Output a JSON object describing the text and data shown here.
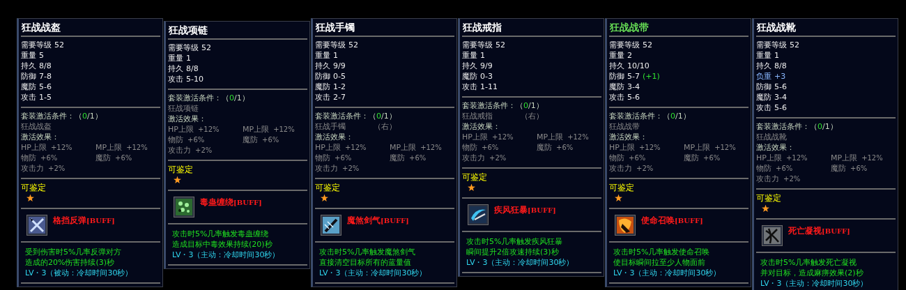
{
  "items": [
    {
      "title": "狂战战盔",
      "color": "#ffffff",
      "stats": [
        {
          "label": "需要等级",
          "value": "52",
          "kind": "base"
        },
        {
          "label": "重量",
          "value": "5",
          "kind": "base"
        },
        {
          "label": "持久",
          "value": "8/8",
          "kind": "base"
        },
        {
          "label": "防御",
          "value": "7-8",
          "kind": "base"
        },
        {
          "label": "魔防",
          "value": "5-6",
          "kind": "base"
        },
        {
          "label": "攻击",
          "value": "1-5",
          "kind": "base"
        }
      ],
      "set": {
        "active": false,
        "label": "套装激活条件：",
        "progress": {
          "before": "（",
          "count": "0",
          "after": "/1）"
        },
        "pieces": [
          {
            "name": "狂战战盔"
          }
        ],
        "effects_label": "激活效果：",
        "effects": [
          {
            "label": "HP上限",
            "value": "+12%"
          },
          {
            "label": "MP上限",
            "value": "+12%"
          },
          {
            "label": "物防",
            "value": "+6%"
          },
          {
            "label": "魔防",
            "value": "+6%"
          },
          {
            "label": "攻击力",
            "value": "+2%"
          }
        ]
      },
      "identify": "可鉴定",
      "skill": {
        "name": "格挡反弹",
        "tag": "[BUFF]",
        "lines": [
          "受到伤害时5%几率反弹对方",
          "造成的20%伤害持续(3)秒"
        ],
        "level_line": "LV・3（被动：冷却时间30秒）"
      }
    },
    {
      "title": "狂战项链",
      "color": "#ffffff",
      "stats": [
        {
          "label": "需要等级",
          "value": "52",
          "kind": "base"
        },
        {
          "label": "重量",
          "value": "1",
          "kind": "base"
        },
        {
          "label": "持久",
          "value": "8/8",
          "kind": "base"
        },
        {
          "label": "攻击",
          "value": "5-10",
          "kind": "base"
        }
      ],
      "set": {
        "active": false,
        "label": "套装激活条件：",
        "progress": {
          "before": "（",
          "count": "0",
          "after": "/1）"
        },
        "pieces": [
          {
            "name": "狂战项链"
          }
        ],
        "effects_label": "激活效果：",
        "effects": [
          {
            "label": "HP上限",
            "value": "+12%"
          },
          {
            "label": "MP上限",
            "value": "+12%"
          },
          {
            "label": "物防",
            "value": "+6%"
          },
          {
            "label": "魔防",
            "value": "+6%"
          },
          {
            "label": "攻击力",
            "value": "+2%"
          }
        ]
      },
      "identify": "可鉴定",
      "skill": {
        "name": "毒蛊缠绕",
        "tag": "[BUFF]",
        "lines": [
          "攻击时5%几率触发毒蛊缠绕",
          "造成目标中毒效果持续(20)秒"
        ],
        "level_line": "LV・3（主动：冷却时间30秒）"
      }
    },
    {
      "title": "狂战手镯",
      "color": "#ffffff",
      "stats": [
        {
          "label": "需要等级",
          "value": "52",
          "kind": "base"
        },
        {
          "label": "重量",
          "value": "1",
          "kind": "base"
        },
        {
          "label": "持久",
          "value": "9/9",
          "kind": "base"
        },
        {
          "label": "防御",
          "value": "0-5",
          "kind": "base"
        },
        {
          "label": "魔防",
          "value": "1-2",
          "kind": "base"
        },
        {
          "label": "攻击",
          "value": "2-7",
          "kind": "base"
        }
      ],
      "set": {
        "active": false,
        "label": "套装激活条件：",
        "progress": {
          "before": "（",
          "count": "0",
          "after": "/1）"
        },
        "pieces": [
          {
            "name": "狂战手镯",
            "slot": "（右）"
          }
        ],
        "effects_label": "激活效果：",
        "effects": [
          {
            "label": "HP上限",
            "value": "+12%"
          },
          {
            "label": "MP上限",
            "value": "+12%"
          },
          {
            "label": "物防",
            "value": "+6%"
          },
          {
            "label": "魔防",
            "value": "+6%"
          },
          {
            "label": "攻击力",
            "value": "+2%"
          }
        ]
      },
      "identify": "可鉴定",
      "skill": {
        "name": "魔煞剑气",
        "tag": "[BUFF]",
        "lines": [
          "攻击时5%几率触发魔煞剑气",
          "直接清空目标所有的蓝量值"
        ],
        "level_line": "LV・3（主动：冷却时间30秒）"
      }
    },
    {
      "title": "狂战戒指",
      "color": "#ffffff",
      "stats": [
        {
          "label": "需要等级",
          "value": "52",
          "kind": "base"
        },
        {
          "label": "重量",
          "value": "1",
          "kind": "base"
        },
        {
          "label": "持久",
          "value": "9/9",
          "kind": "base"
        },
        {
          "label": "魔防",
          "value": "0-3",
          "kind": "base"
        },
        {
          "label": "攻击",
          "value": "1-11",
          "kind": "base"
        }
      ],
      "set": {
        "active": false,
        "label": "套装激活条件：",
        "progress": {
          "before": "（",
          "count": "0",
          "after": "/1）"
        },
        "pieces": [
          {
            "name": "狂战戒指",
            "slot": "（右）"
          }
        ],
        "effects_label": "激活效果：",
        "effects": [
          {
            "label": "HP上限",
            "value": "+12%"
          },
          {
            "label": "MP上限",
            "value": "+12%"
          },
          {
            "label": "物防",
            "value": "+6%"
          },
          {
            "label": "魔防",
            "value": "+6%"
          },
          {
            "label": "攻击力",
            "value": "+2%"
          }
        ]
      },
      "identify": "可鉴定",
      "skill": {
        "name": "疾风狂暴",
        "tag": "[BUFF]",
        "lines": [
          "攻击时5%几率触发疾风狂暴",
          "瞬间提升2倍攻速持续(3)秒"
        ],
        "level_line": "LV・3（主动：冷却时间30秒）"
      }
    },
    {
      "title": "狂战战带",
      "color": "#66dd55",
      "stats": [
        {
          "label": "需要等级",
          "value": "52",
          "kind": "base"
        },
        {
          "label": "重量",
          "value": "2",
          "kind": "base"
        },
        {
          "label": "持久",
          "value": "10/10",
          "kind": "base"
        },
        {
          "label": "防御",
          "value": "5-7",
          "bonus": "(+1)",
          "kind": "base"
        },
        {
          "label": "魔防",
          "value": "3-4",
          "kind": "base"
        },
        {
          "label": "攻击",
          "value": "5-6",
          "kind": "base"
        }
      ],
      "set": {
        "active": false,
        "label": "套装激活条件：",
        "progress": {
          "before": "（",
          "count": "0",
          "after": "/1）"
        },
        "pieces": [
          {
            "name": "狂战战带"
          }
        ],
        "effects_label": "激活效果：",
        "effects": [
          {
            "label": "HP上限",
            "value": "+12%"
          },
          {
            "label": "MP上限",
            "value": "+12%"
          },
          {
            "label": "物防",
            "value": "+6%"
          },
          {
            "label": "魔防",
            "value": "+6%"
          },
          {
            "label": "攻击力",
            "value": "+2%"
          }
        ]
      },
      "identify": "可鉴定",
      "skill": {
        "name": "使命召唤",
        "tag": "[BUFF]",
        "lines": [
          "攻击时5%几率触发使命召唤",
          "使目标瞬间拉至少人物面前"
        ],
        "level_line": "LV・3（主动：冷却时间30秒）"
      }
    },
    {
      "title": "狂战战靴",
      "color": "#ffffff",
      "stats": [
        {
          "label": "需要等级",
          "value": "52",
          "kind": "base"
        },
        {
          "label": "重量",
          "value": "1",
          "kind": "base"
        },
        {
          "label": "持久",
          "value": "8/8",
          "kind": "base"
        },
        {
          "label": "负重",
          "value": "+3",
          "kind": "extra"
        },
        {
          "label": "防御",
          "value": "5-6",
          "kind": "base"
        },
        {
          "label": "魔防",
          "value": "3-4",
          "kind": "base"
        },
        {
          "label": "攻击",
          "value": "5-6",
          "kind": "base"
        }
      ],
      "set": {
        "active": false,
        "label": "套装激活条件：",
        "progress": {
          "before": "（",
          "count": "0",
          "after": "/1）"
        },
        "pieces": [
          {
            "name": "狂战战靴"
          }
        ],
        "effects_label": "激活效果：",
        "effects": [
          {
            "label": "HP上限",
            "value": "+12%"
          },
          {
            "label": "MP上限",
            "value": "+12%"
          },
          {
            "label": "物防",
            "value": "+6%"
          },
          {
            "label": "魔防",
            "value": "+6%"
          },
          {
            "label": "攻击力",
            "value": "+2%"
          }
        ]
      },
      "identify": "可鉴定",
      "skill": {
        "name": "死亡凝视",
        "tag": "[BUFF]",
        "lines": [
          "攻击时5%几率触发死亡凝视",
          "并对目标，造成麻痹效果(2)秒"
        ],
        "level_line": "LV・3（主动：冷却时间30秒）"
      }
    }
  ]
}
